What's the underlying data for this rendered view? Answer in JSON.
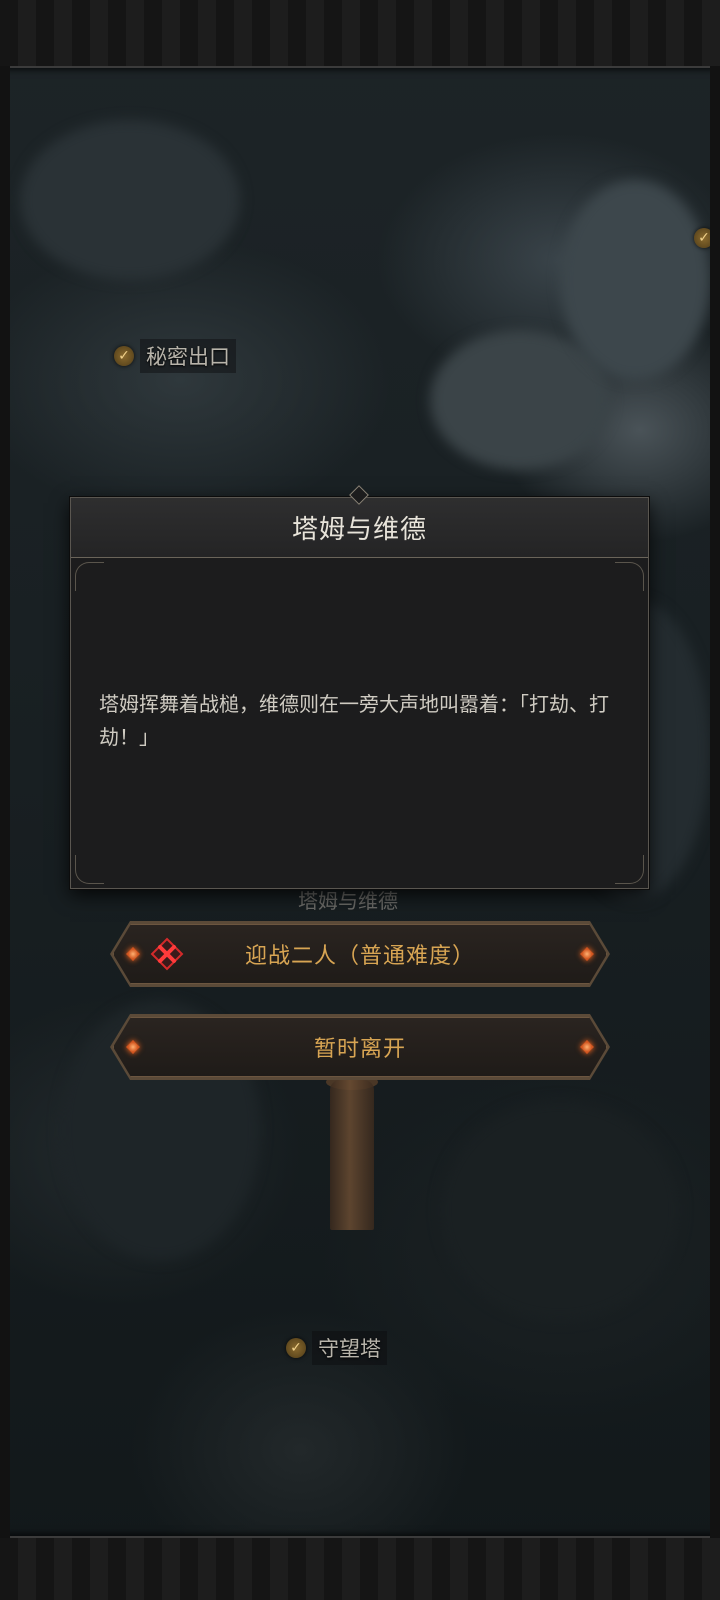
{
  "map": {
    "markers": [
      {
        "label": "秘密出口",
        "icon": "check-icon"
      },
      {
        "label": "守望塔",
        "icon": "check-icon"
      }
    ]
  },
  "event_dialog": {
    "title": "塔姆与维德",
    "body": "塔姆挥舞着战槌，维德则在一旁大声地叫嚣着：「打劫、打劫！」"
  },
  "background_node_label": "塔姆与维德",
  "options": [
    {
      "label": "迎战二人（普通难度）",
      "icon": "crossed-swords-icon"
    },
    {
      "label": "暂时离开"
    }
  ],
  "colors": {
    "button_text": "#d8a553",
    "accent_gem": "#d0541e",
    "battle_icon": "#d42a2a"
  }
}
